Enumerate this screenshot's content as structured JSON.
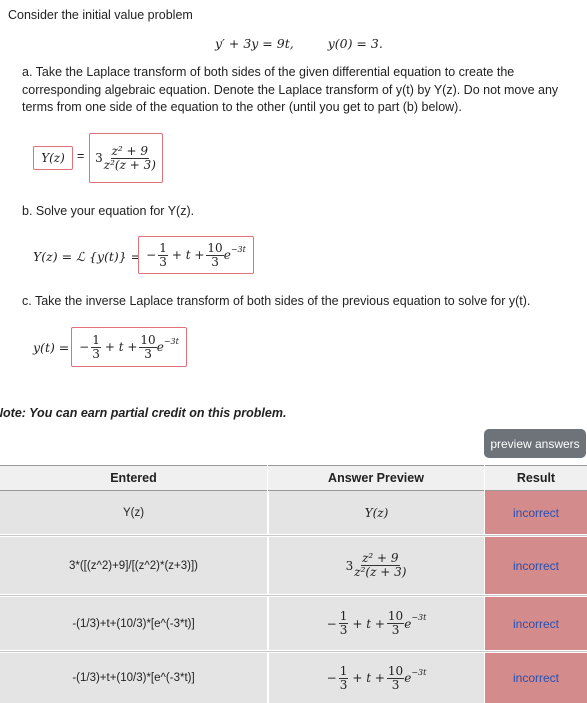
{
  "intro": "Consider the initial value problem",
  "ivp": {
    "de": "y′ + 3y = 9t,",
    "ic": "y(0) = 3."
  },
  "part_a": {
    "text": "a. Take the Laplace transform of both sides of the given differential equation to create the corresponding algebraic equation. Denote the Laplace transform of y(t) by Y(z). Do not move any terms from one side of the equation to the other (until you get to part (b) below).",
    "answer_left": "Y(z)",
    "equals": "=",
    "answer_right_coef": "3",
    "answer_right_num": "z² + 9",
    "answer_right_den": "z²(z + 3)"
  },
  "part_b": {
    "text": "b. Solve your equation for Y(z).",
    "lhs": "Y(z) = ℒ {y(t)} =",
    "ans_sign": "−",
    "ans_frac1_num": "1",
    "ans_frac1_den": "3",
    "ans_mid": "+ t +",
    "ans_frac2_num": "10",
    "ans_frac2_den": "3",
    "ans_exp_base": "e",
    "ans_exp_pow": "−3t"
  },
  "part_c": {
    "text": "c. Take the inverse Laplace transform of both sides of the previous equation to solve for y(t).",
    "lhs": "y(t) =",
    "ans_sign": "−",
    "ans_frac1_num": "1",
    "ans_frac1_den": "3",
    "ans_mid": "+ t +",
    "ans_frac2_num": "10",
    "ans_frac2_den": "3",
    "ans_exp_base": "e",
    "ans_exp_pow": "−3t"
  },
  "note": "Note: You can earn partial credit on this problem.",
  "preview_button": "preview answers",
  "table": {
    "headers": [
      "Entered",
      "Answer Preview",
      "Result"
    ],
    "rows": [
      {
        "entered": "Y(z)",
        "preview": "Y(z)",
        "result": "incorrect"
      },
      {
        "entered": "3*([(z^2)+9]/[(z^2)*(z+3)])",
        "preview_coef": "3",
        "preview_num": "z² + 9",
        "preview_den": "z²(z + 3)",
        "result": "incorrect"
      },
      {
        "entered": "-(1/3)+t+(10/3)*[e^(-3*t)]",
        "preview_sign": "−",
        "preview_f1n": "1",
        "preview_f1d": "3",
        "preview_mid": "+ t +",
        "preview_f2n": "10",
        "preview_f2d": "3",
        "preview_exp": "−3t",
        "result": "incorrect"
      },
      {
        "entered": "-(1/3)+t+(10/3)*[e^(-3*t)]",
        "preview_sign": "−",
        "preview_f1n": "1",
        "preview_f1d": "3",
        "preview_mid": "+ t +",
        "preview_f2n": "10",
        "preview_f2d": "3",
        "preview_exp": "−3t",
        "result": "incorrect"
      }
    ]
  },
  "colors": {
    "answer_border": "#e0707a",
    "result_bg": "#d48b8b",
    "result_text": "#2a4fb0",
    "button_bg": "#6d7378"
  }
}
